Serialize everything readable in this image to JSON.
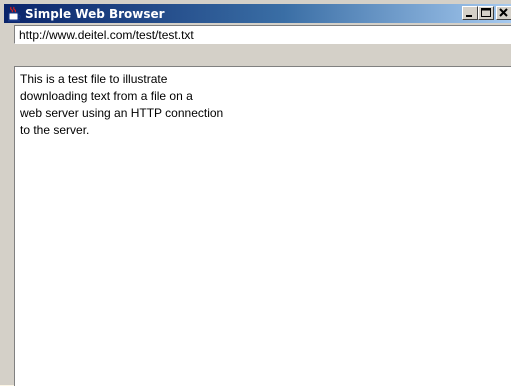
{
  "window": {
    "title": "Simple Web Browser",
    "icon": "java-cup-icon",
    "buttons": {
      "minimize": "minimize-icon",
      "maximize": "maximize-icon",
      "close": "close-icon"
    },
    "colors": {
      "title_start": "#0a246a",
      "title_end": "#a6caf0",
      "face": "#d4d0c8"
    }
  },
  "url_field": {
    "value": "http://www.deitel.com/test/test.txt"
  },
  "content": {
    "lines": [
      "This is a test file to illustrate",
      "downloading text from a file on a",
      "web server using an HTTP connection",
      "to the server."
    ]
  }
}
